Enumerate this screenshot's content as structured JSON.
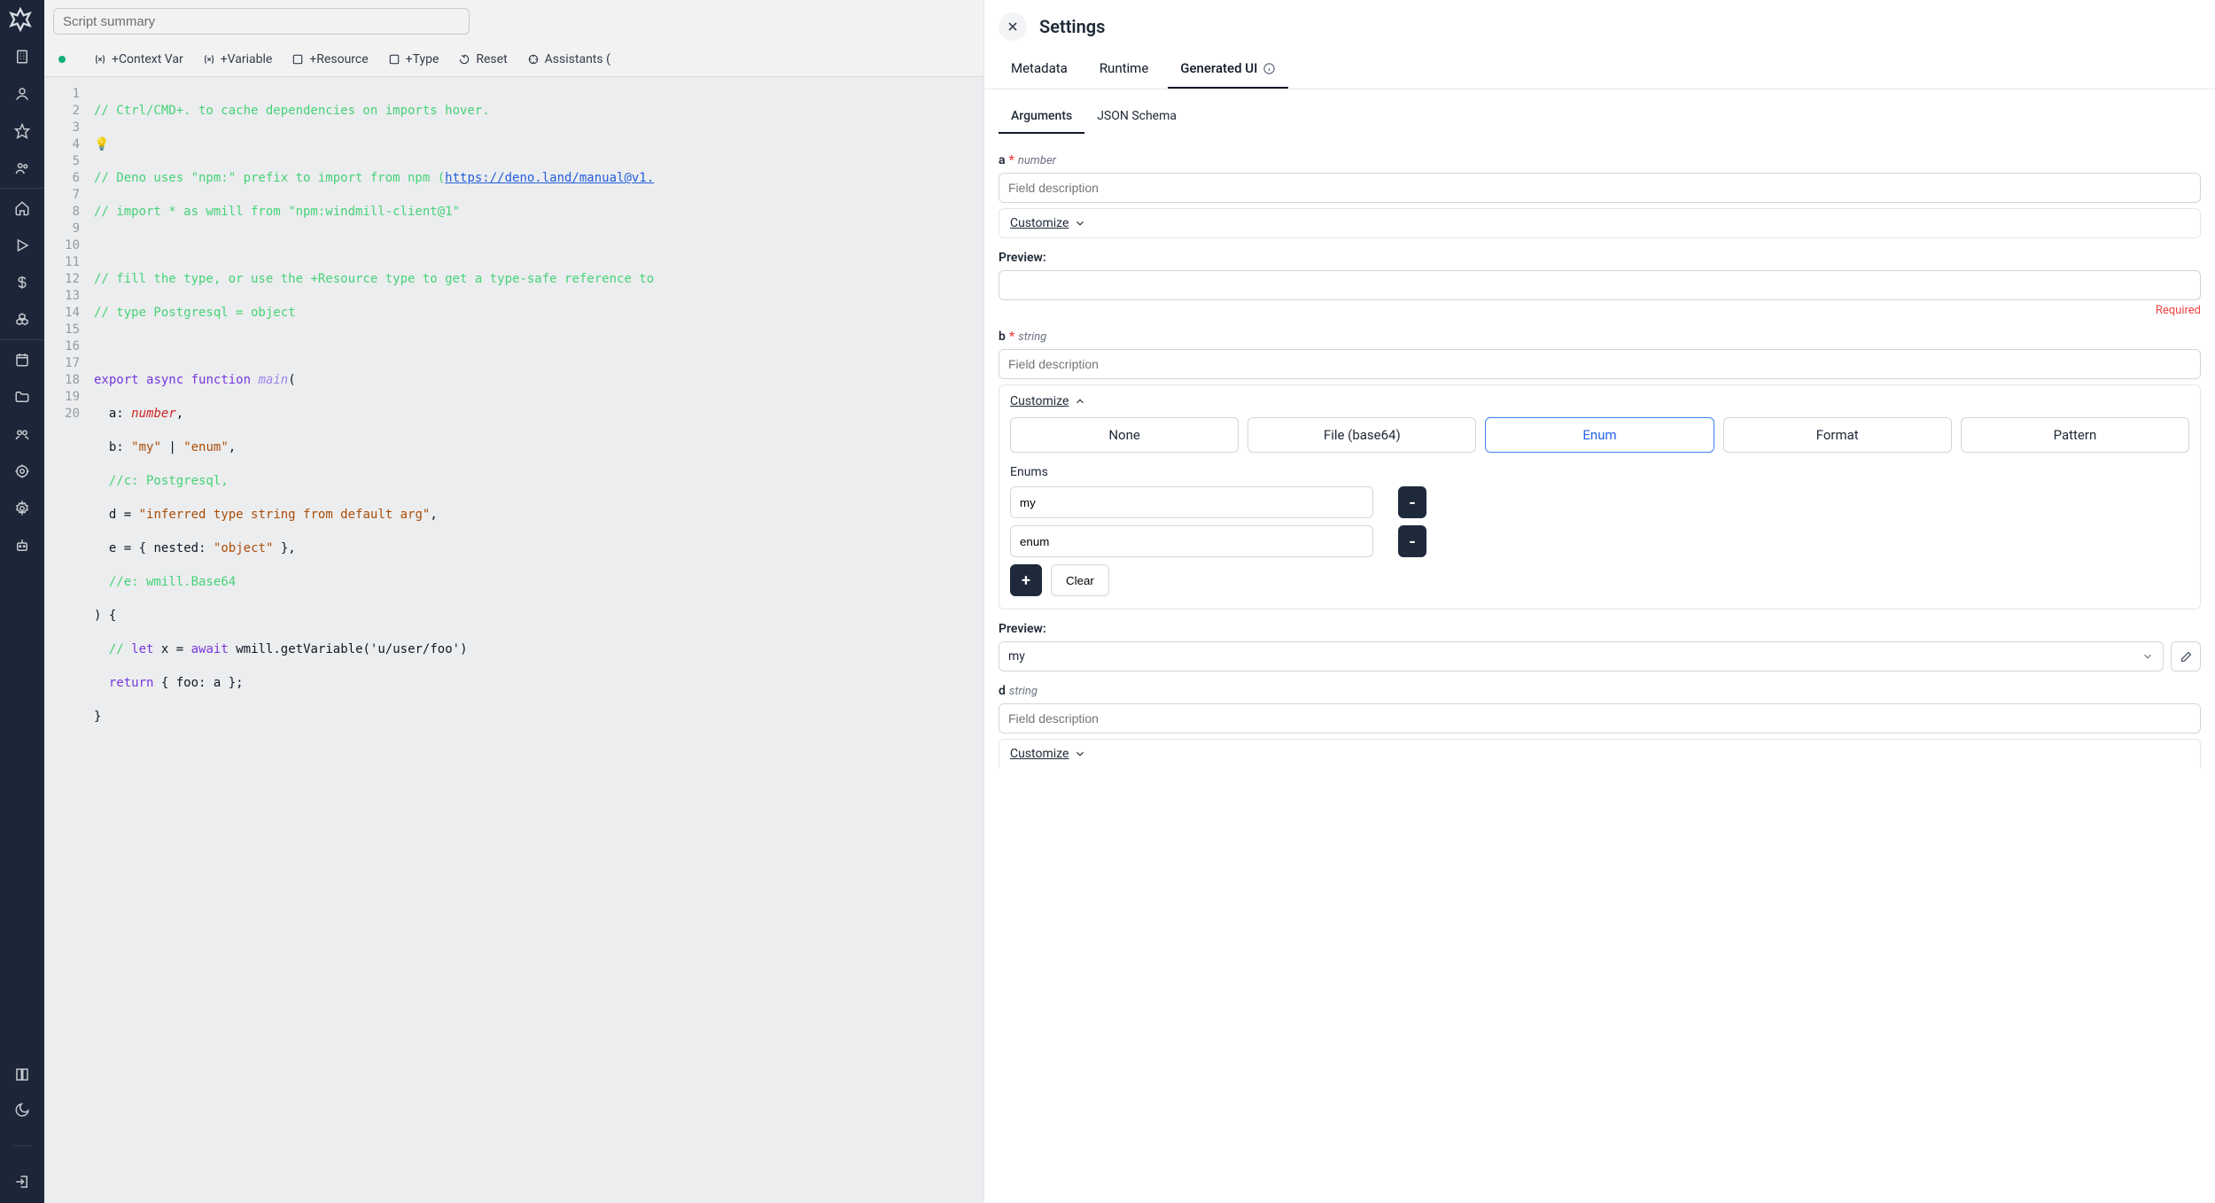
{
  "summary_placeholder": "Script summary",
  "toolbar": {
    "context": "+Context Var",
    "variable": "+Variable",
    "resource": "+Resource",
    "type": "+Type",
    "reset": "Reset",
    "assistants": "Assistants ("
  },
  "code": {
    "l1": "// Ctrl/CMD+. to cache dependencies on imports hover.",
    "l3a": "// Deno uses \"npm:\" prefix to import from npm (",
    "l3b": "https://deno.land/manual@v1.",
    "l4": "// import * as wmill from \"npm:windmill-client@1\"",
    "l6": "// fill the type, or use the +Resource type to get a type-safe reference to",
    "l7": "// type Postgresql = object",
    "l9_export": "export",
    "l9_async": "async",
    "l9_func": "function",
    "l9_main": "main",
    "l9_open": "(",
    "l10_a": "a",
    "l10_colon": ":",
    "l10_num": "number",
    "l10_comma": ",",
    "l11_b": "b",
    "l11_colon": ":",
    "l11_s1": "\"my\"",
    "l11_pipe": "|",
    "l11_s2": "\"enum\"",
    "l11_comma": ",",
    "l12": "//c: Postgresql,",
    "l13_d": "d",
    "l13_eq": "=",
    "l13_s": "\"inferred type string from default arg\"",
    "l13_comma": ",",
    "l14_e": "e",
    "l14_eq": "=",
    "l14_open": "{",
    "l14_nested": "nested",
    "l14_colon": ":",
    "l14_obj": "\"object\"",
    "l14_close": "},",
    "l15": "//e: wmill.Base64",
    "l16": ") {",
    "l17_c": "// ",
    "l17_let": "let",
    "l17_x": "x =",
    "l17_await": "await",
    "l17_call": "wmill.getVariable('u/user/foo')",
    "l18_ret": "return",
    "l18_body": "{ foo: a };",
    "l19": "}"
  },
  "panel": {
    "title": "Settings",
    "tabs": {
      "meta": "Metadata",
      "runtime": "Runtime",
      "gen": "Generated UI"
    },
    "subtabs": {
      "args": "Arguments",
      "json": "JSON Schema"
    },
    "a": {
      "name": "a",
      "type": "number",
      "desc_ph": "Field description",
      "customize": "Customize",
      "preview": "Preview:",
      "required": "Required"
    },
    "b": {
      "name": "b",
      "type": "string",
      "desc_ph": "Field description",
      "customize": "Customize",
      "kinds": {
        "none": "None",
        "file": "File (base64)",
        "enum": "Enum",
        "format": "Format",
        "pattern": "Pattern"
      },
      "enums_label": "Enums",
      "enum1": "my",
      "enum2": "enum",
      "clear": "Clear",
      "preview": "Preview:",
      "preview_val": "my"
    },
    "d": {
      "name": "d",
      "type": "string",
      "desc_ph": "Field description",
      "customize": "Customize"
    }
  }
}
